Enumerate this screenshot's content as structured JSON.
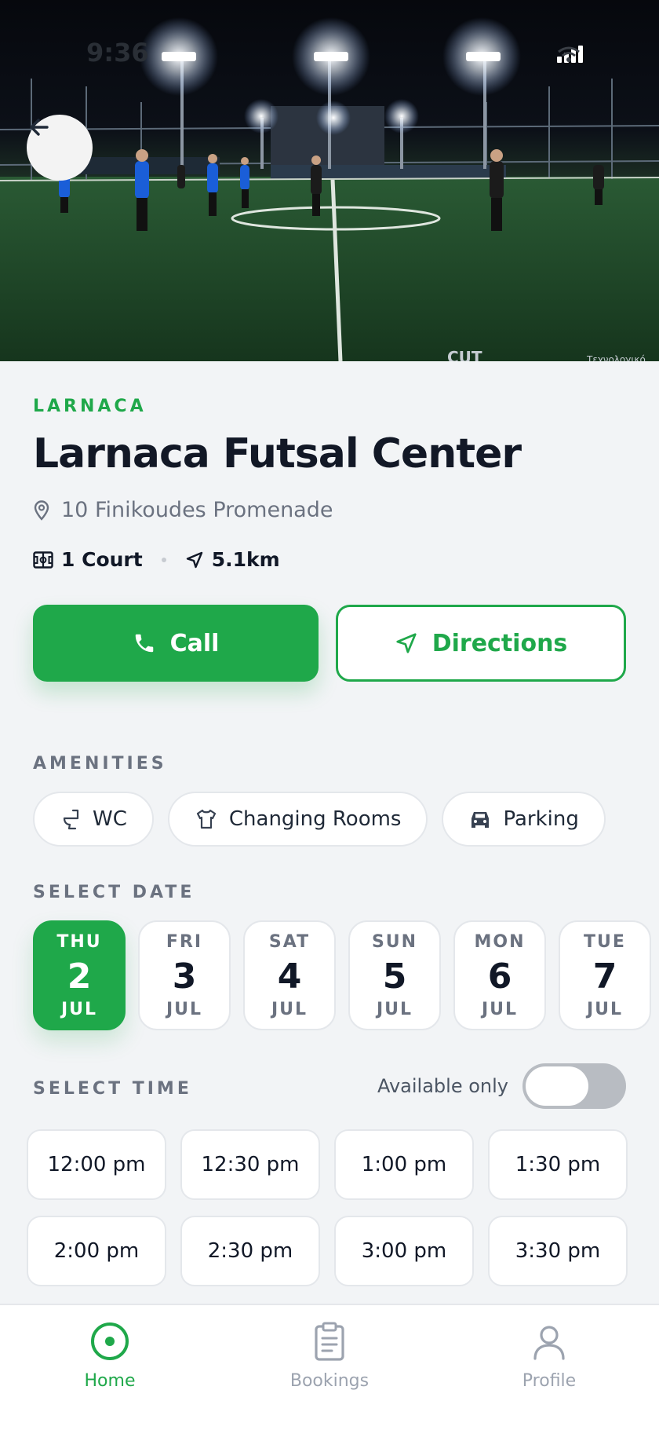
{
  "status_bar": {
    "time": "9:36"
  },
  "hero": {
    "back_label": "Back"
  },
  "venue": {
    "region": "LARNACA",
    "name": "Larnaca Futsal Center",
    "address": "10 Finikoudes Promenade",
    "courts": "1 Court",
    "distance": "5.1km"
  },
  "actions": {
    "call": "Call",
    "directions": "Directions"
  },
  "amenities": {
    "label": "AMENITIES",
    "items": [
      {
        "label": "WC",
        "icon": "toilet-icon"
      },
      {
        "label": "Changing Rooms",
        "icon": "shirt-icon"
      },
      {
        "label": "Parking",
        "icon": "car-icon"
      }
    ]
  },
  "date_select": {
    "label": "SELECT DATE",
    "selected": "Thu 2 Jul",
    "dates": [
      {
        "dow": "THU",
        "day": "2",
        "month": "JUL"
      },
      {
        "dow": "FRI",
        "day": "3",
        "month": "JUL"
      },
      {
        "dow": "SAT",
        "day": "4",
        "month": "JUL"
      },
      {
        "dow": "SUN",
        "day": "5",
        "month": "JUL"
      },
      {
        "dow": "MON",
        "day": "6",
        "month": "JUL"
      },
      {
        "dow": "TUE",
        "day": "7",
        "month": "JUL"
      }
    ]
  },
  "time_select": {
    "label": "SELECT TIME",
    "available_only_label": "Available only",
    "available_only": false,
    "slots": [
      "12:00 pm",
      "12:30 pm",
      "1:00 pm",
      "1:30 pm",
      "2:00 pm",
      "2:30 pm",
      "3:00 pm",
      "3:30 pm"
    ]
  },
  "bottom_nav": {
    "items": [
      {
        "label": "Home",
        "icon": "home-target-icon",
        "active": true
      },
      {
        "label": "Bookings",
        "icon": "clipboard-icon",
        "active": false
      },
      {
        "label": "Profile",
        "icon": "user-icon",
        "active": false
      }
    ]
  },
  "colors": {
    "accent": "#1fa84a",
    "background": "#f2f4f6",
    "text": "#111827",
    "muted": "#6b7280"
  }
}
